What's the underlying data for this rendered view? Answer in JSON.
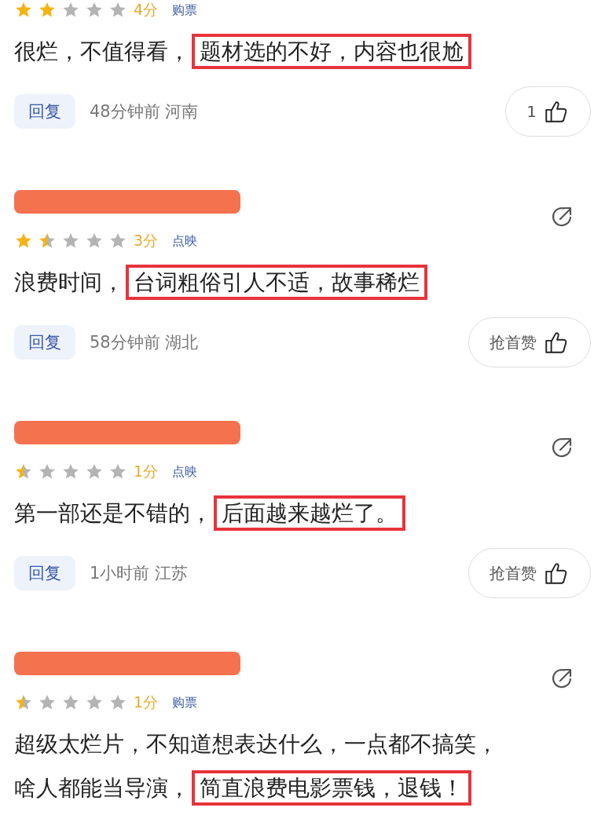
{
  "comments": [
    {
      "stars": 2,
      "score": "4分",
      "source": "购票",
      "text": [
        {
          "t": "很烂，不值得看，",
          "boxed": false
        },
        {
          "t": "题材选的不好，内容也很尬",
          "boxed": true
        }
      ],
      "reply": "回复",
      "meta": "48分钟前 河南",
      "like": "1"
    },
    {
      "redacted": true,
      "share": true,
      "stars": 1.5,
      "score": "3分",
      "source": "点映",
      "text": [
        {
          "t": "浪费时间，",
          "boxed": false
        },
        {
          "t": "台词粗俗引人不适，故事稀烂",
          "boxed": true
        }
      ],
      "reply": "回复",
      "meta": "58分钟前 湖北",
      "like": "抢首赞"
    },
    {
      "redacted": true,
      "share": true,
      "stars": 0.5,
      "score": "1分",
      "source": "点映",
      "text": [
        {
          "t": "第一部还是不错的，",
          "boxed": false
        },
        {
          "t": "后面越来越烂了。",
          "boxed": true
        }
      ],
      "reply": "回复",
      "meta": "1小时前 江苏",
      "like": "抢首赞"
    },
    {
      "redacted": true,
      "share": true,
      "stars": 0.5,
      "score": "1分",
      "source": "购票",
      "text": [
        {
          "t": "超级太烂片，不知道想表达什么，一点都不搞笑，",
          "boxed": false
        },
        {
          "t": "啥人都能当导演，",
          "boxed": false,
          "newline": true
        },
        {
          "t": "简直浪费电影票钱，退钱！",
          "boxed": true
        }
      ]
    }
  ]
}
